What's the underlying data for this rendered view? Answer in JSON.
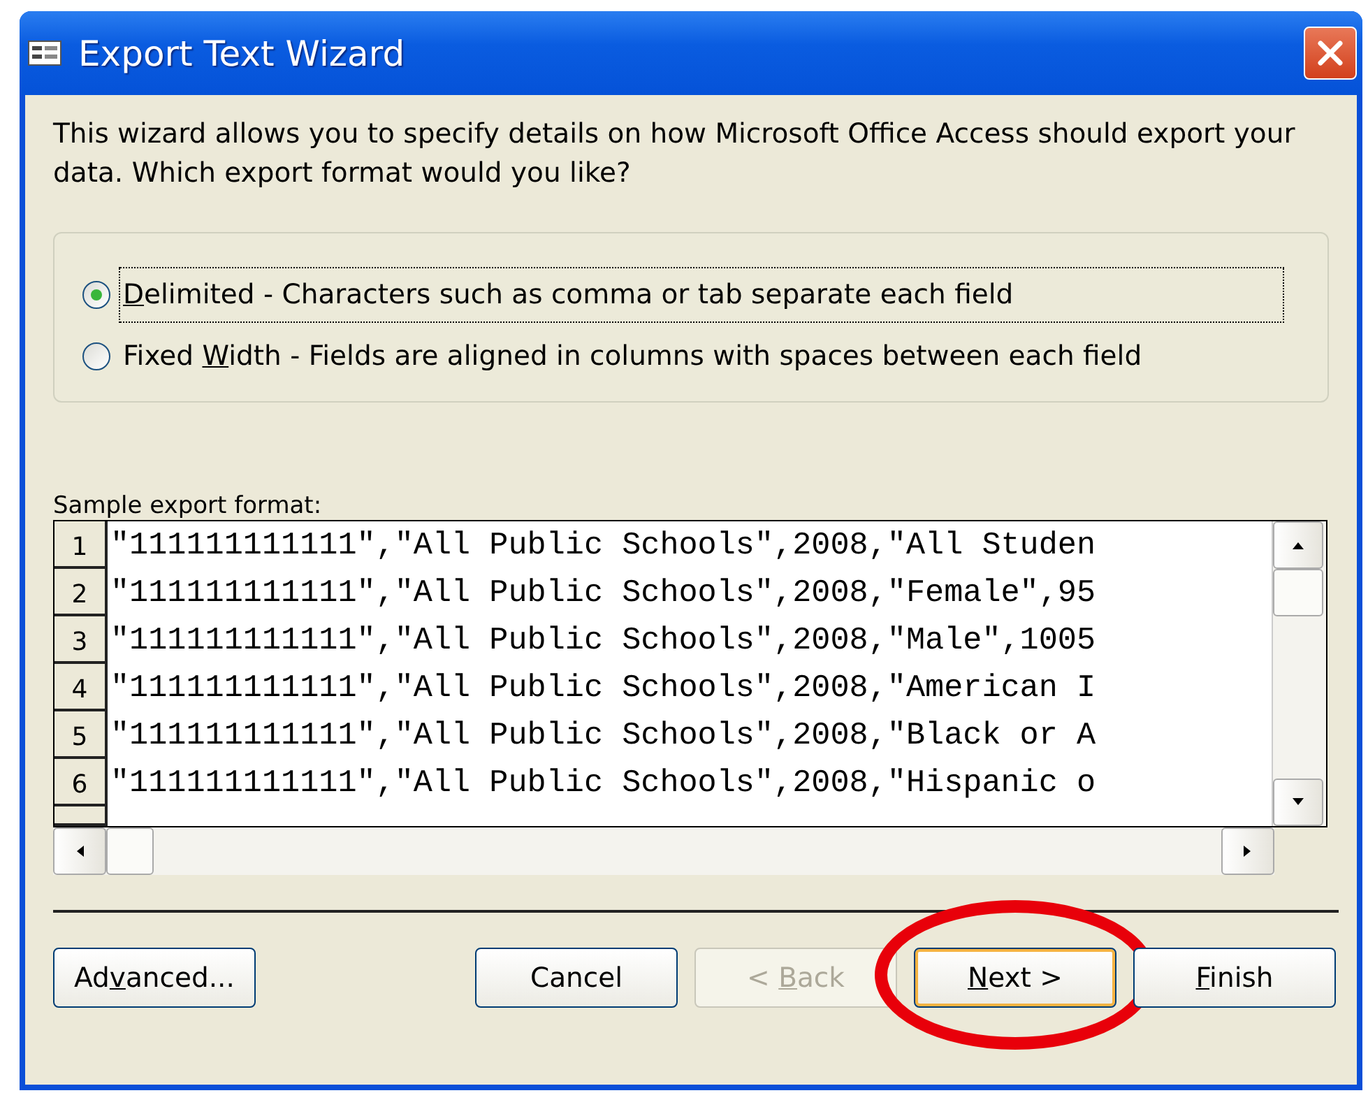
{
  "window": {
    "title": "Export Text Wizard"
  },
  "intro": "This wizard allows you to specify details on how Microsoft Office Access should export your data. Which export format would you like?",
  "formats": [
    {
      "key": "D",
      "post": "elimited - Characters such as comma or tab separate each field",
      "selected": true,
      "focused": true
    },
    {
      "pre": "Fixed ",
      "key": "W",
      "post": "idth - Fields are aligned in columns with spaces between each field",
      "selected": false,
      "focused": false
    }
  ],
  "sample": {
    "label": "Sample export format:",
    "rows": [
      {
        "number": "1",
        "text": "\"111111111111\",\"All Public Schools\",2008,\"All Studen"
      },
      {
        "number": "2",
        "text": "\"111111111111\",\"All Public Schools\",2008,\"Female\",95"
      },
      {
        "number": "3",
        "text": "\"111111111111\",\"All Public Schools\",2008,\"Male\",1005"
      },
      {
        "number": "4",
        "text": "\"111111111111\",\"All Public Schools\",2008,\"American I"
      },
      {
        "number": "5",
        "text": "\"111111111111\",\"All Public Schools\",2008,\"Black or A"
      },
      {
        "number": "6",
        "text": "\"111111111111\",\"All Public Schools\",2008,\"Hispanic o"
      }
    ]
  },
  "buttons": [
    {
      "pre": "Ad",
      "key": "v",
      "post": "anced...",
      "kind": "left",
      "disabled": false,
      "default": false,
      "highlighted": false
    },
    {
      "post": "Cancel",
      "kind": "right",
      "disabled": false,
      "default": false,
      "highlighted": false
    },
    {
      "pre": "< ",
      "key": "B",
      "post": "ack",
      "kind": "right",
      "disabled": true,
      "default": false,
      "highlighted": false
    },
    {
      "key": "N",
      "post": "ext >",
      "kind": "right",
      "disabled": false,
      "default": true,
      "highlighted": true
    },
    {
      "key": "F",
      "post": "inish",
      "kind": "right",
      "disabled": false,
      "default": false,
      "highlighted": false
    }
  ]
}
